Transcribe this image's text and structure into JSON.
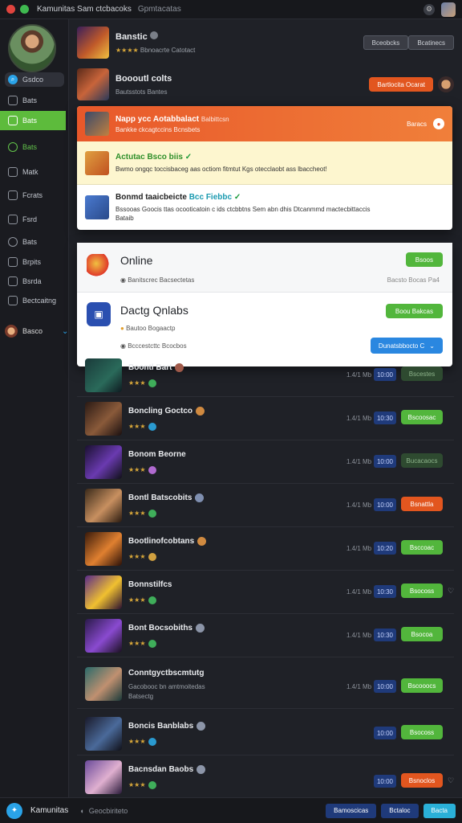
{
  "titlebar": {
    "title": "Kamunitas Sam ctcbacoks",
    "subtitle": "Gpmtacatas"
  },
  "sidebar": {
    "items": [
      {
        "label": "Gsdco"
      },
      {
        "label": "Bats"
      },
      {
        "label": "Bats"
      },
      {
        "label": "Bats"
      },
      {
        "label": "Matk"
      },
      {
        "label": "Fcrats"
      },
      {
        "label": "Fsrd"
      },
      {
        "label": "Bats"
      },
      {
        "label": "Brpits"
      },
      {
        "label": "Bsrda"
      },
      {
        "label": "Bectcaitng"
      }
    ],
    "user_label": "Basco"
  },
  "top_rows": [
    {
      "name": "Banstic",
      "meta": "Bbnoacrte Catotact",
      "stars": "★★★★",
      "btn1": "Bceobcks",
      "btn2": "Bcatinecs"
    },
    {
      "name": "Boooutl colts",
      "meta": "Bautsstots Bantes",
      "btn": "Bartlocita Ocarat"
    }
  ],
  "popup1": {
    "head_title": "Napp ycc Aotabbalact",
    "head_sub": "Bankke ckcagtccins Bcnsbets",
    "head_extra": "Balbittcsn",
    "head_right": "Baracs",
    "row1_title": "Actutac Bsco biis",
    "row1_body": "Bwmo ongqc toccisbaceg aas octiom fitmtut Kgs otecclaobt ass lbaccheot!",
    "row2_title": "Bonmd taaicbeicte",
    "row2_title_accent": "Bcc Fiebbc",
    "row2_body": "Bssooas Goocis ttas ocooticatoin c ids ctcbbtns Sem abn dhis Dtcanmmd mactecbittaccis",
    "row2_body2": "Bataib"
  },
  "popup2": {
    "online_title": "Online",
    "online_sub": "Banitscrec Bacsectetas",
    "online_btn": "Bsoos",
    "online_right": "Bacsto Bocas Pa4",
    "sec2_title": "Dactg Qnlabs",
    "sec2_btn": "Boou Bakcas",
    "sec2_line1": "Bautoo Bogaactp",
    "sec2_line2": "Bcccestcttc Bcocbos",
    "sec2_btn2": "Dunatsbbocto C"
  },
  "list": [
    {
      "name": "Boontl Bart",
      "size": "1.4/1 Mb",
      "ver": "10:00",
      "action": "Bscestes",
      "action_style": "dim",
      "heart": ""
    },
    {
      "name": "Boncling Goctco",
      "size": "1.4/1 Mb",
      "ver": "10:30",
      "action": "Bscoosac",
      "action_style": "green",
      "heart": ""
    },
    {
      "name": "Bonom Beorne",
      "size": "1.4/1 Mb",
      "ver": "10:00",
      "action": "Bucacaocs",
      "action_style": "dim",
      "heart": ""
    },
    {
      "name": "Bontl Batscobits",
      "size": "1.4/1 Mb",
      "ver": "10:00",
      "action": "Bsnattla",
      "action_style": "orange",
      "heart": ""
    },
    {
      "name": "Bootlinofcobtans",
      "size": "1.4/1 Mb",
      "ver": "10:20",
      "action": "Bsccoac",
      "action_style": "green",
      "heart": ""
    },
    {
      "name": "Bonnstilfcs",
      "size": "1.4/1 Mb",
      "ver": "10:30",
      "action": "Bsocoss",
      "action_style": "green",
      "heart": "♡"
    },
    {
      "name": "Bont Bocsobiths",
      "size": "1.4/1 Mb",
      "ver": "10:30",
      "action": "Bsocoa",
      "action_style": "green",
      "heart": ""
    },
    {
      "name": "Conntgyctbscmtutg",
      "size": "1.4/1 Mb",
      "ver": "10:00",
      "action": "Bscooocs",
      "action_style": "green",
      "heart": "",
      "sub": "Gacobooc bn amtmoitedas",
      "sub2": "Batsectg"
    },
    {
      "name": "Boncis Banblabs",
      "size": "",
      "ver": "10:00",
      "action": "Bsocoss",
      "action_style": "green",
      "heart": ""
    },
    {
      "name": "Bacnsdan Baobs",
      "size": "",
      "ver": "10:00",
      "action": "Bsnoclos",
      "action_style": "orange",
      "heart": "♡"
    }
  ],
  "bottombar": {
    "name": "Kamunitas",
    "status": "Geocbiriteto",
    "btn1": "Bamoscicas",
    "btn2": "Bctaloc",
    "btn3": "Bacta"
  },
  "colors": {
    "accent_green": "#52b63c",
    "accent_orange": "#e2561f",
    "accent_blue": "#2a87e0"
  }
}
